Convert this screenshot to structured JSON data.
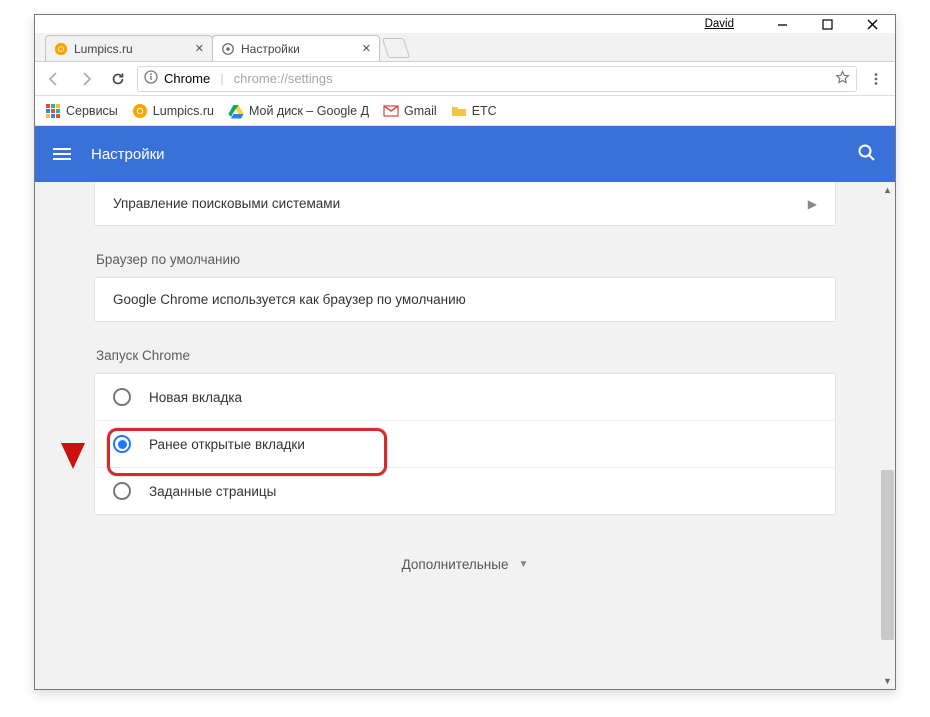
{
  "window": {
    "user_name": "David"
  },
  "tabs": [
    {
      "title": "Lumpics.ru",
      "icon": "orange-circle-icon",
      "active": false
    },
    {
      "title": "Настройки",
      "icon": "gear-icon",
      "active": true
    }
  ],
  "address_bar": {
    "scheme_label": "Chrome",
    "url_path": "chrome://settings"
  },
  "bookmarks": [
    {
      "label": "Сервисы",
      "icon": "apps-grid-icon"
    },
    {
      "label": "Lumpics.ru",
      "icon": "orange-circle-icon"
    },
    {
      "label": "Мой диск – Google Д",
      "icon": "drive-icon"
    },
    {
      "label": "Gmail",
      "icon": "gmail-icon"
    },
    {
      "label": "ETC",
      "icon": "folder-icon"
    }
  ],
  "blue_header": {
    "title": "Настройки"
  },
  "settings": {
    "search_engines_row": "Управление поисковыми системами",
    "default_browser_section": "Браузер по умолчанию",
    "default_browser_text": "Google Chrome используется как браузер по умолчанию",
    "on_startup_section": "Запуск Chrome",
    "on_startup_options": [
      {
        "label": "Новая вкладка",
        "selected": false
      },
      {
        "label": "Ранее открытые вкладки",
        "selected": true
      },
      {
        "label": "Заданные страницы",
        "selected": false
      }
    ],
    "advanced_label": "Дополнительные"
  }
}
